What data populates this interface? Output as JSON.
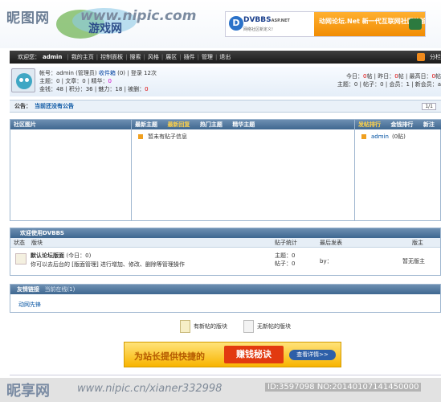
{
  "watermark": {
    "logo_text": "昵图网",
    "url": "www.nipic.com",
    "bottom_logo": "昵享网",
    "bottom_url": "www.nipic.cn/xianer332998",
    "bottom_id": "ID:3597098 NO:20140107141450000"
  },
  "banner": {
    "brand": "DVBBS",
    "brand_suffix": "ASP.NET",
    "brand_sub": "网络社区新定义!",
    "promo": "动网论坛.Net 新一代互联网社区体验"
  },
  "nav": {
    "welcome": "欢迎您：",
    "username": "admin",
    "items": [
      "我的主页",
      "控制面板",
      "搜索",
      "风格",
      "展区",
      "插件",
      "管理",
      "退出"
    ],
    "right": "分栏"
  },
  "user": {
    "line1_prefix": "帐号：admin (管理员)",
    "inbox": "收件箱",
    "inbox_count": "(0)",
    "login": "| 登录 12次",
    "line2": "主题：0 | 文章：0 | 精华：",
    "line2_val": "0",
    "line3_prefix": "金钱：48 | 积分：36 | 魅力：18 | 被删：",
    "line3_val": "0"
  },
  "stats": {
    "line1_a": "今日：",
    "today": "0",
    "line1_b": "帖 | 昨日：",
    "yesterday": "0",
    "line1_c": "帖 | 最高日：",
    "max_day": "0",
    "line1_d": "帖",
    "line2": "主题：0 | 帖子：0 | 会员：1 | 新会员：a"
  },
  "announcement": {
    "label": "公告：",
    "text": "当前还没有公告",
    "page": "1/1"
  },
  "panels": {
    "left_title": "社区图片",
    "mid_tabs": [
      "最新主题",
      "最新回复",
      "热门主题",
      "精华主题"
    ],
    "mid_active": 1,
    "mid_item": "暂未有贴子信息",
    "right_tabs": [
      "发帖排行",
      "金钱排行",
      "新注册"
    ],
    "right_item": "admin",
    "right_item_count": "(0贴)"
  },
  "forum": {
    "header": "欢迎使用DVBBS",
    "columns": [
      "状态",
      "版块",
      "贴子统计",
      "最后发表",
      "版主"
    ],
    "row": {
      "name": "默认论坛版面",
      "today": "(今日：0)",
      "desc": "你可以去后台的 [版面管理] 进行增加、修改、删除等管理操作",
      "topics": "主题：0",
      "posts": "帖子：0",
      "last": "by：",
      "mod": "暂无版主"
    }
  },
  "links": {
    "title": "友情链接",
    "subtitle": "当前在线(1)",
    "item": "动网先锋"
  },
  "legend": {
    "new": "有新帖的版块",
    "none": "无新帖的版块"
  },
  "ad2": {
    "text1": "为站长提供快捷的",
    "text2": "赚钱秘诀",
    "button": "查看详情>>"
  }
}
